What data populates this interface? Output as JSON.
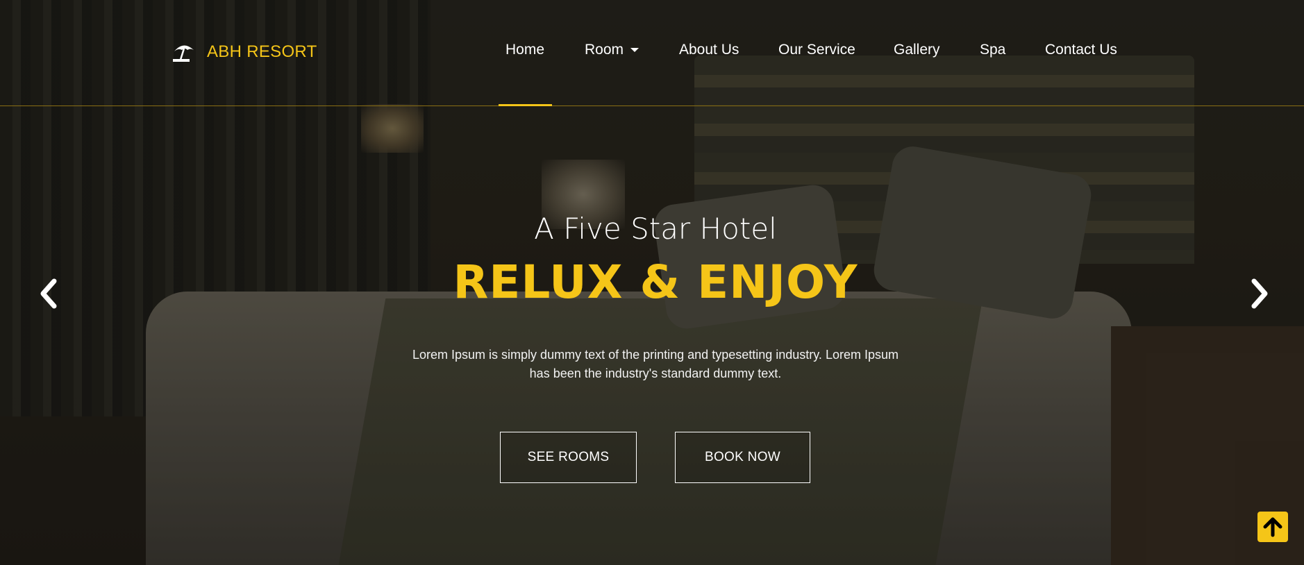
{
  "brand": {
    "name": "ABH RESORT",
    "icon": "beach-umbrella-icon",
    "accent": "#f5c518"
  },
  "nav": {
    "items": [
      {
        "label": "Home",
        "active": true
      },
      {
        "label": "Room",
        "dropdown": true
      },
      {
        "label": "About Us"
      },
      {
        "label": "Our Service"
      },
      {
        "label": "Gallery"
      },
      {
        "label": "Spa"
      },
      {
        "label": "Contact Us"
      }
    ]
  },
  "hero": {
    "subtitle": "A Five Star Hotel",
    "title": "RELUX & ENJOY",
    "description": "Lorem Ipsum is simply dummy text of the printing and typesetting industry. Lorem Ipsum has been the industry's standard dummy text.",
    "buttons": {
      "see_rooms": "SEE ROOMS",
      "book_now": "BOOK NOW"
    },
    "prev_icon": "chevron-left-icon",
    "next_icon": "chevron-right-icon"
  },
  "back_to_top": {
    "icon": "arrow-up-icon"
  }
}
